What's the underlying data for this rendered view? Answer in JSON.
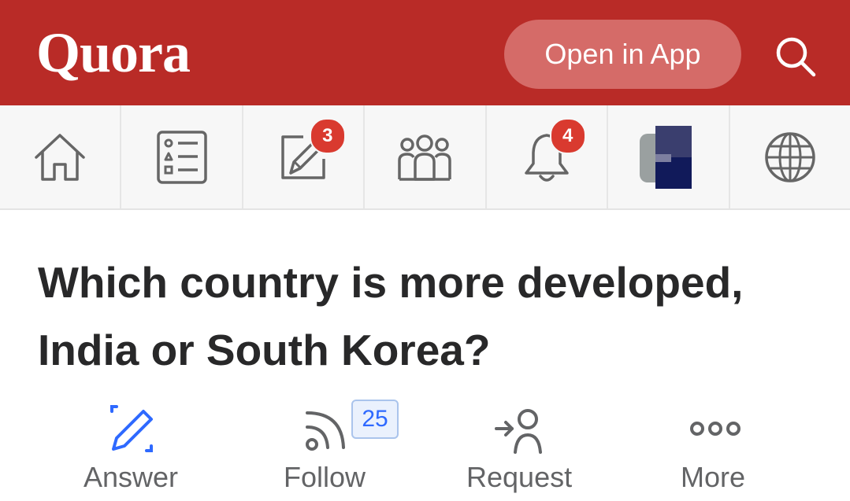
{
  "header": {
    "logo": "Quora",
    "open_in_app_label": "Open in App",
    "brand_color": "#b92b27",
    "search_icon": "search-icon"
  },
  "nav": {
    "items": [
      {
        "name": "home",
        "icon": "home-icon"
      },
      {
        "name": "answer",
        "icon": "list-icon"
      },
      {
        "name": "write",
        "icon": "edit-icon",
        "badge": "3"
      },
      {
        "name": "spaces",
        "icon": "spaces-icon"
      },
      {
        "name": "notifications",
        "icon": "bell-icon",
        "badge": "4"
      },
      {
        "name": "profile",
        "icon": "avatar"
      },
      {
        "name": "languages",
        "icon": "globe-icon"
      }
    ],
    "badge_color": "#d93a2f"
  },
  "question": {
    "title": "Which country is more developed, India or South Korea?"
  },
  "actions": {
    "answer_label": "Answer",
    "follow_label": "Follow",
    "follow_count": "25",
    "request_label": "Request",
    "more_label": "More",
    "accent_color": "#2e69ff"
  }
}
